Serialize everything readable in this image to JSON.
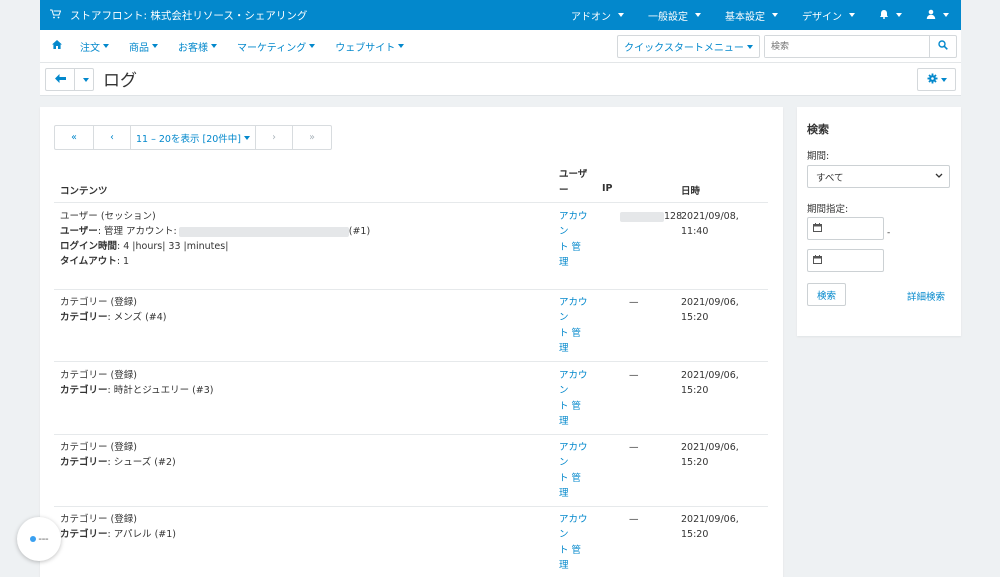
{
  "topbar": {
    "brand": "ストアフロント: 株式会社リソース・シェアリング",
    "menus": [
      "アドオン",
      "一般設定",
      "基本設定",
      "デザイン"
    ]
  },
  "nav": {
    "items": [
      "注文",
      "商品",
      "お客様",
      "マーケティング",
      "ウェブサイト"
    ],
    "quickstart": "クイックスタートメニュー",
    "search_placeholder": "検索"
  },
  "title": "ログ",
  "pager": {
    "first": "«",
    "prev": "‹",
    "label": "11 – 20を表示 [20件中]",
    "next": "›",
    "last": "»"
  },
  "table": {
    "headers": {
      "content": "コンテンツ",
      "user_line1": "ユーザ",
      "user_line2": "ー",
      "ip": "IP",
      "date": "日時"
    },
    "rows": [
      {
        "title": "ユーザー (セッション)",
        "l1_label": "ユーザー",
        "l1_value": ": 管理 アカウント:",
        "l1_suffix": "(#1)",
        "l2_label": "ログイン時間",
        "l2_value": ": 4 |hours| 33 |minutes|",
        "l3_label": "タイムアウト",
        "l3_value": ": 1",
        "user": [
          "アカウ",
          "ン",
          "ト 管",
          "理"
        ],
        "ip_suffix": "128",
        "date": "2021/09/08, 11:40"
      },
      {
        "title": "カテゴリー (登録)",
        "l1_label": "カテゴリー",
        "l1_value": ": メンズ (#4)",
        "user": [
          "アカウ",
          "ン",
          "ト 管",
          "理"
        ],
        "ip": "—",
        "date": "2021/09/06, 15:20"
      },
      {
        "title": "カテゴリー (登録)",
        "l1_label": "カテゴリー",
        "l1_value": ": 時計とジュエリー (#3)",
        "user": [
          "アカウ",
          "ン",
          "ト 管",
          "理"
        ],
        "ip": "—",
        "date": "2021/09/06, 15:20"
      },
      {
        "title": "カテゴリー (登録)",
        "l1_label": "カテゴリー",
        "l1_value": ": シューズ (#2)",
        "user": [
          "アカウ",
          "ン",
          "ト 管",
          "理"
        ],
        "ip": "—",
        "date": "2021/09/06, 15:20"
      },
      {
        "title": "カテゴリー (登録)",
        "l1_label": "カテゴリー",
        "l1_value": ": アパレル (#1)",
        "user": [
          "アカウ",
          "ン",
          "ト 管",
          "理"
        ],
        "ip": "—",
        "date": "2021/09/06, 15:20"
      }
    ]
  },
  "sidebar": {
    "title": "検索",
    "period_label": "期間:",
    "period_value": "すべて",
    "range_label": "期間指定:",
    "range_dash": "-",
    "search_button": "検索",
    "advanced_link": "詳細検索"
  },
  "icons": {
    "cart": "cart-icon",
    "home": "home-icon",
    "bell": "bell-icon",
    "user": "user-icon",
    "back": "arrow-left-icon",
    "gear": "gear-icon",
    "search": "search-icon",
    "calendar": "calendar-icon"
  },
  "colors": {
    "primary": "#0388cc",
    "background": "#eef1f3"
  }
}
